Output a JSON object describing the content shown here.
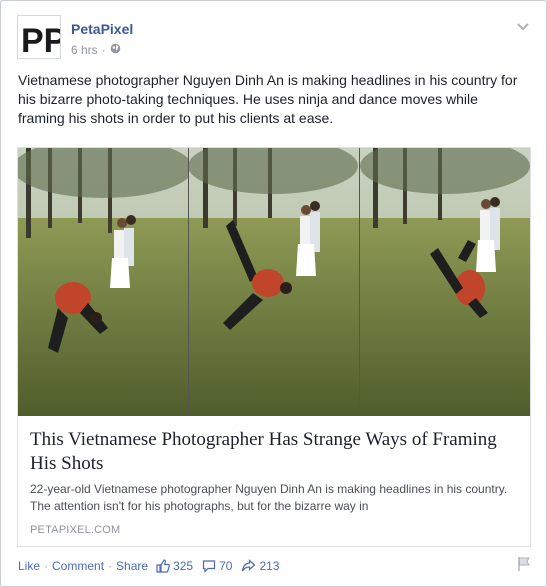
{
  "post": {
    "page_name": "PetaPixel",
    "timestamp": "6 hrs",
    "message": "Vietnamese photographer Nguyen Dinh An is making headlines in his country for his bizarre photo-taking techniques. He uses ninja and dance moves while framing his shots in order to put his clients at ease.",
    "avatar_letters": "PP"
  },
  "link": {
    "title": "This Vietnamese Photographer Has Strange Ways of Framing His Shots",
    "description": "22-year-old Vietnamese photographer Nguyen Dinh An is making headlines in his country. The attention isn't for his photographs, but for the bizarre way in",
    "domain": "PETAPIXEL.COM"
  },
  "actions": {
    "like": "Like",
    "comment": "Comment",
    "share": "Share",
    "separator": "·"
  },
  "stats": {
    "likes": "325",
    "comments": "70",
    "shares": "213"
  },
  "colors": {
    "link_blue": "#4b6ab2",
    "page_name": "#3b5998",
    "logo_blue": "#1f6fb5"
  },
  "icons": {
    "globe": "globe-icon",
    "chevron": "chevron-down-icon",
    "like": "thumbs-up-icon",
    "comment": "comment-icon",
    "share": "share-arrow-icon",
    "flag": "flag-icon"
  }
}
